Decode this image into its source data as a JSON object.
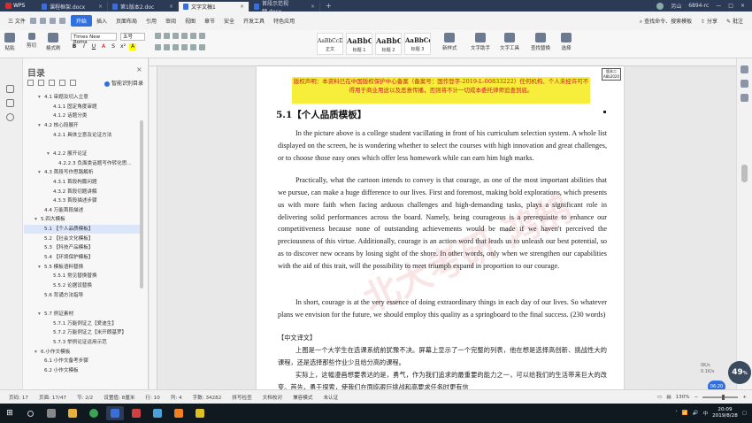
{
  "titlebar": {
    "app": "WPS",
    "tabs": [
      {
        "label": "课程框架.docx",
        "active": false
      },
      {
        "label": "第1版本2.doc",
        "active": false
      },
      {
        "label": "文字文稿1",
        "active": true
      },
      {
        "label": "首段示范视频.docx",
        "active": false
      }
    ],
    "right": {
      "user": "另山",
      "code": "6894-rc"
    }
  },
  "menubar": {
    "file": "三 文件",
    "items": [
      "开始",
      "插入",
      "页面布局",
      "引用",
      "审阅",
      "视图",
      "章节",
      "安全",
      "开发工具",
      "特色应用"
    ],
    "search": "查找命令、搜索模板",
    "share": "分享",
    "comment": "批注"
  },
  "ribbon": {
    "paste": "粘贴",
    "cut": "剪切",
    "copy_fmt": "格式刷",
    "font_name": "Times New Roma",
    "font_size": "五号",
    "styles": [
      {
        "preview": "AaBbCcDd",
        "label": "正文"
      },
      {
        "preview": "AaBbC",
        "label": "标题 1"
      },
      {
        "preview": "AaBbC",
        "label": "标题 2"
      },
      {
        "preview": "AaBbCcl",
        "label": "标题 3"
      }
    ],
    "new_style": "新样式",
    "text_assistant": "文字助手",
    "text_tools": "文字工具",
    "find_replace": "查找替换",
    "select": "选择"
  },
  "nav": {
    "title": "目录",
    "smart": "智能识别目录",
    "items": [
      {
        "level": 2,
        "label": "4.1  审题及切入立意",
        "arrow": "▾"
      },
      {
        "level": 3,
        "label": "4.1.1  固定角度审题",
        "arrow": ""
      },
      {
        "level": 3,
        "label": "4.1.2  话题分类",
        "arrow": ""
      },
      {
        "level": 2,
        "label": "4.2  核心段展开",
        "arrow": "▾"
      },
      {
        "level": 3,
        "label": "4.2.1  具体立意及论证方法",
        "arrow": ""
      },
      {
        "level": 3,
        "label": "",
        "arrow": ""
      },
      {
        "level": 3,
        "label": "4.2.2  展开论证",
        "arrow": "▾"
      },
      {
        "level": 4,
        "label": "4.2.2.3  负面类话题写作转化思...",
        "arrow": ""
      },
      {
        "level": 2,
        "label": "4.3  首段写作思路解析",
        "arrow": "▾"
      },
      {
        "level": 3,
        "label": "4.3.1  首段构篇问题",
        "arrow": ""
      },
      {
        "level": 3,
        "label": "4.3.2  首段切题讲解",
        "arrow": ""
      },
      {
        "level": 3,
        "label": "4.3.3  首段描述步骤",
        "arrow": ""
      },
      {
        "level": 2,
        "label": "4.4  万能首段描述",
        "arrow": ""
      },
      {
        "level": 1,
        "label": "5.四大模板",
        "arrow": "▾"
      },
      {
        "level": 2,
        "label": "5.1  【个人品质模板】",
        "arrow": "",
        "selected": true
      },
      {
        "level": 2,
        "label": "5.2  【社会文化模板】",
        "arrow": ""
      },
      {
        "level": 2,
        "label": "5.3  【科技产品模板】",
        "arrow": ""
      },
      {
        "level": 2,
        "label": "5.4  【环境保护模板】",
        "arrow": ""
      },
      {
        "level": 2,
        "label": "5.5  模板语料替换",
        "arrow": "▾"
      },
      {
        "level": 3,
        "label": "5.5.1  常见替换替换",
        "arrow": ""
      },
      {
        "level": 3,
        "label": "5.5.2  论据设替换",
        "arrow": ""
      },
      {
        "level": 2,
        "label": "5.6  背诵方法指导",
        "arrow": ""
      },
      {
        "level": 2,
        "label": "",
        "arrow": ""
      },
      {
        "level": 2,
        "label": "5.7  例证素材",
        "arrow": "▾"
      },
      {
        "level": 3,
        "label": "5.7.1  万能例证之【爱迪生】",
        "arrow": ""
      },
      {
        "level": 3,
        "label": "5.7.2  万能例证之【米开朗基罗】",
        "arrow": ""
      },
      {
        "level": 3,
        "label": "5.7.3  举例论证运用示范",
        "arrow": ""
      },
      {
        "level": 1,
        "label": "6.小作文模板",
        "arrow": "▾"
      },
      {
        "level": 2,
        "label": "6.1  小作文备考步骤",
        "arrow": ""
      },
      {
        "level": 2,
        "label": "6.2  小作文模板",
        "arrow": ""
      }
    ]
  },
  "document": {
    "notice": "版权声明：本资料已在中国版权保护中心备案（备案号：国作登字-2019-L-00833222）任何机构、个人未经许可不得用于商业用途以及恶意传播，否则将不计一切成本委托律师追查到底。",
    "stamp": "版本二 A8b2020",
    "heading": "5.1【个人品质模板】",
    "watermark": "北大考研 鸿鹄",
    "paragraphs": [
      "In the picture above is a college student vacillating in front of his curriculum selection system. A whole list displayed on the screen, he is wondering whether to select the courses with high innovation and great challenges, or to choose those easy ones which offer less homework while can earn him high marks.",
      "Practically, what the cartoon intends to convey is that courage, as one of the most important abilities that we pursue, can make a huge difference to our lives. First and foremost, making bold explorations, which presents us with more faith when facing arduous challenges and high-demanding tasks, plays a significant role in delivering solid performances across the board. Namely, being courageous is a prerequisite to enhance our competitiveness because none of outstanding achievements would be made if we haven't perceived the preciousness of this virtue. Additionally, courage is an action word that leads us to unleash our best potential, so as to discover new oceans by losing sight of the shore. In other words, only when we strengthen our capabilities with the aid of this trait, will the possibility to meet triumph expand in proportion to our courage.",
      "In short, courage is at the very essence of doing extraordinary things in each day of our lives. So whatever plans we envision for the future, we should employ this quality as a springboard to the final success. (230 words)"
    ],
    "cn_heading": "【中文译文】",
    "cn_paragraphs": [
      "上图是一个大学生在选课系统前犹豫不决。屏幕上显示了一个完整的列表，他在想是选择高创新、挑战性大的课程，还是选择那些作业少且给分高的课程。",
      "实际上，这幅漫画想要表达的是，勇气，作为我们追求的最重要的能力之一，可以给我们的生活带来巨大的改变。首先，勇于探索，使我们在面临艰巨挑战和高要求任务时更有信"
    ]
  },
  "statusbar": {
    "items": [
      "页码: 17",
      "页面: 17/47",
      "节: 2/2",
      "设置值: 8厘米",
      "行: 10",
      "列: 4",
      "字数: 34282",
      "拼写检查",
      "文档校对",
      "兼容模式",
      "未认证"
    ],
    "zoom": "130%"
  },
  "widgets": {
    "score": "49",
    "score_unit": "%",
    "timer": "06:20",
    "net_up": "0K/s",
    "net_down": "0.1K/s"
  },
  "taskbar": {
    "time": "20:09",
    "date": "2019/8/28",
    "lang": "中"
  }
}
